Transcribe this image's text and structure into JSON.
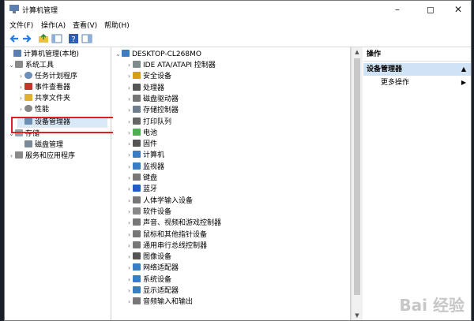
{
  "window": {
    "title": "计算机管理"
  },
  "menu": [
    "文件(F)",
    "操作(A)",
    "查看(V)",
    "帮助(H)"
  ],
  "left_tree": [
    {
      "label": "计算机管理(本地)",
      "indent": 0,
      "exp": "",
      "icon": "computer-icon",
      "color": "#5b7fb0"
    },
    {
      "label": "系统工具",
      "indent": 1,
      "exp": "v",
      "icon": "tools-icon",
      "color": "#8a8a8a"
    },
    {
      "label": "任务计划程序",
      "indent": 2,
      "exp": ">",
      "icon": "clock-icon",
      "color": "#6d8fb8"
    },
    {
      "label": "事件查看器",
      "indent": 2,
      "exp": ">",
      "icon": "event-log-icon",
      "color": "#c0392b"
    },
    {
      "label": "共享文件夹",
      "indent": 2,
      "exp": ">",
      "icon": "shared-folder-icon",
      "color": "#e0b030"
    },
    {
      "label": "性能",
      "indent": 2,
      "exp": ">",
      "icon": "performance-icon",
      "color": "#888888"
    },
    {
      "label": "设备管理器",
      "indent": 2,
      "exp": "",
      "icon": "device-manager-icon",
      "color": "#6b8fb0"
    },
    {
      "label": "存储",
      "indent": 1,
      "exp": "v",
      "icon": "storage-icon",
      "color": "#9aa3ad"
    },
    {
      "label": "磁盘管理",
      "indent": 2,
      "exp": "",
      "icon": "disk-icon",
      "color": "#7a8a99"
    },
    {
      "label": "服务和应用程序",
      "indent": 1,
      "exp": ">",
      "icon": "services-icon",
      "color": "#8a8a8a"
    }
  ],
  "device_tree": {
    "root": "DESKTOP-CL268MO",
    "items": [
      {
        "label": "IDE ATA/ATAPI 控制器",
        "icon": "ide-icon",
        "color": "#7f8c8d"
      },
      {
        "label": "安全设备",
        "icon": "security-icon",
        "color": "#d4a017"
      },
      {
        "label": "处理器",
        "icon": "cpu-icon",
        "color": "#555555"
      },
      {
        "label": "磁盘驱动器",
        "icon": "disk-drive-icon",
        "color": "#777777"
      },
      {
        "label": "存储控制器",
        "icon": "storage-controller-icon",
        "color": "#6f7f8f"
      },
      {
        "label": "打印队列",
        "icon": "printer-icon",
        "color": "#666666"
      },
      {
        "label": "电池",
        "icon": "battery-icon",
        "color": "#4caf50"
      },
      {
        "label": "固件",
        "icon": "firmware-icon",
        "color": "#555555"
      },
      {
        "label": "计算机",
        "icon": "computer-icon",
        "color": "#3b7dc4"
      },
      {
        "label": "监视器",
        "icon": "monitor-icon",
        "color": "#3b7dc4"
      },
      {
        "label": "键盘",
        "icon": "keyboard-icon",
        "color": "#777777"
      },
      {
        "label": "蓝牙",
        "icon": "bluetooth-icon",
        "color": "#1f5fbf"
      },
      {
        "label": "人体学输入设备",
        "icon": "hid-icon",
        "color": "#777777"
      },
      {
        "label": "软件设备",
        "icon": "software-device-icon",
        "color": "#888888"
      },
      {
        "label": "声音、视频和游戏控制器",
        "icon": "sound-icon",
        "color": "#777777"
      },
      {
        "label": "鼠标和其他指针设备",
        "icon": "mouse-icon",
        "color": "#777777"
      },
      {
        "label": "通用串行总线控制器",
        "icon": "usb-icon",
        "color": "#777777"
      },
      {
        "label": "图像设备",
        "icon": "camera-icon",
        "color": "#555555"
      },
      {
        "label": "网络适配器",
        "icon": "network-icon",
        "color": "#3b7dc4"
      },
      {
        "label": "系统设备",
        "icon": "system-device-icon",
        "color": "#3b7dc4"
      },
      {
        "label": "显示适配器",
        "icon": "display-adapter-icon",
        "color": "#3b7dc4"
      },
      {
        "label": "音频输入和输出",
        "icon": "audio-io-icon",
        "color": "#777777"
      }
    ]
  },
  "actions": {
    "header": "操作",
    "selected": "设备管理器",
    "more": "更多操作"
  },
  "watermark": "Bai 经验"
}
